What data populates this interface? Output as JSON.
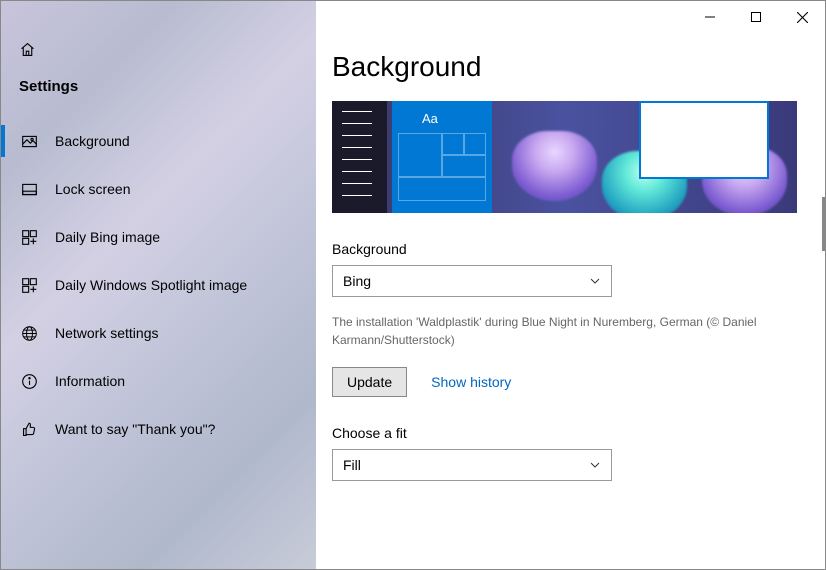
{
  "sidebar": {
    "header": "Settings",
    "items": [
      {
        "label": "Background",
        "icon": "picture-icon",
        "active": true
      },
      {
        "label": "Lock screen",
        "icon": "lockscreen-icon",
        "active": false
      },
      {
        "label": "Daily Bing image",
        "icon": "grid-plus-icon",
        "active": false
      },
      {
        "label": "Daily Windows Spotlight image",
        "icon": "grid-plus-icon",
        "active": false
      },
      {
        "label": "Network settings",
        "icon": "globe-icon",
        "active": false
      },
      {
        "label": "Information",
        "icon": "info-icon",
        "active": false
      },
      {
        "label": "Want to say \"Thank you\"?",
        "icon": "thumbs-up-icon",
        "active": false
      }
    ]
  },
  "main": {
    "title": "Background",
    "preview_sample_text": "Aa",
    "background_label": "Background",
    "background_value": "Bing",
    "caption": "The installation 'Waldplastik' during Blue Night in Nuremberg, German (© Daniel Karmann/Shutterstock)",
    "update_label": "Update",
    "show_history_label": "Show history",
    "fit_label": "Choose a fit",
    "fit_value": "Fill"
  }
}
